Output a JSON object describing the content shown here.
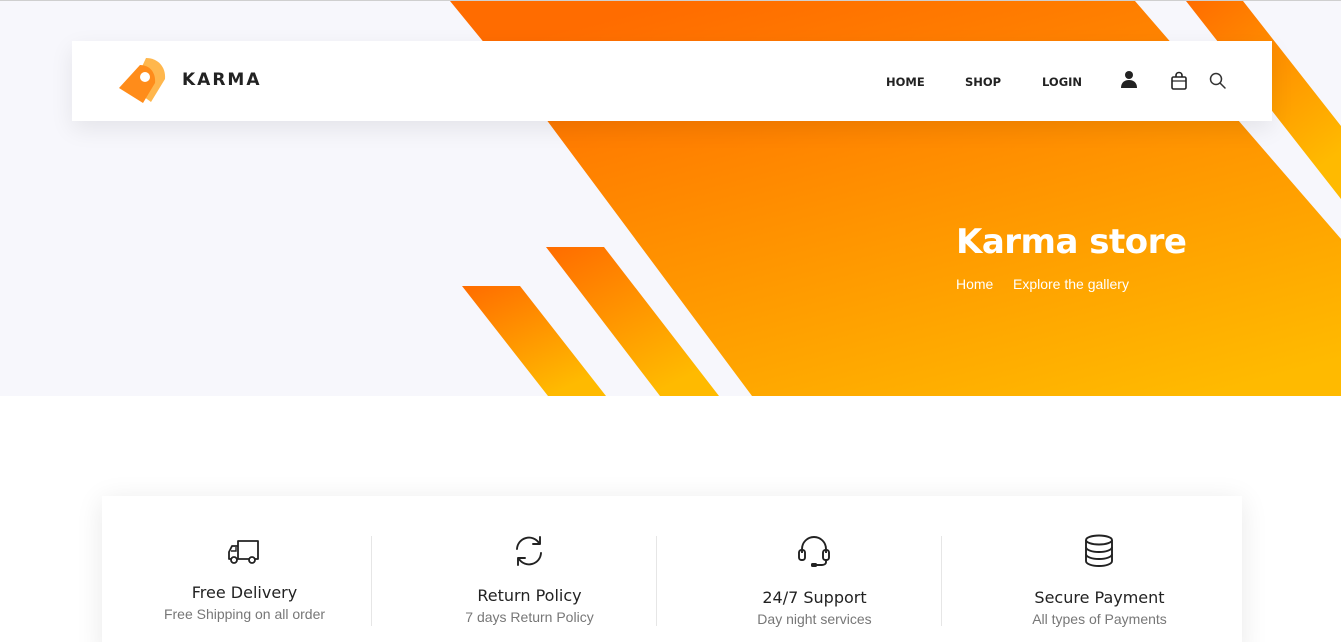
{
  "header": {
    "brand": "KARMA",
    "nav": {
      "home": "HOME",
      "shop": "SHOP",
      "login": "LOGIN"
    },
    "icons": [
      "user-icon",
      "cart-icon",
      "search-icon"
    ]
  },
  "hero": {
    "title": "Karma store",
    "breadcrumb": {
      "home": "Home",
      "current": "Explore the gallery"
    }
  },
  "features": [
    {
      "icon": "truck-icon",
      "title": "Free Delivery",
      "subtitle": "Free Shipping on all order"
    },
    {
      "icon": "refresh-icon",
      "title": "Return Policy",
      "subtitle": "7 days Return Policy"
    },
    {
      "icon": "headset-icon",
      "title": "24/7 Support",
      "subtitle": "Day night services"
    },
    {
      "icon": "coins-icon",
      "title": "Secure Payment",
      "subtitle": "All types of Payments"
    }
  ],
  "colors": {
    "accent_orange": "#ff6c00",
    "accent_yellow": "#ffba00",
    "hero_background": "#f7f7fc",
    "text_dark": "#222222",
    "text_muted": "#777777"
  }
}
